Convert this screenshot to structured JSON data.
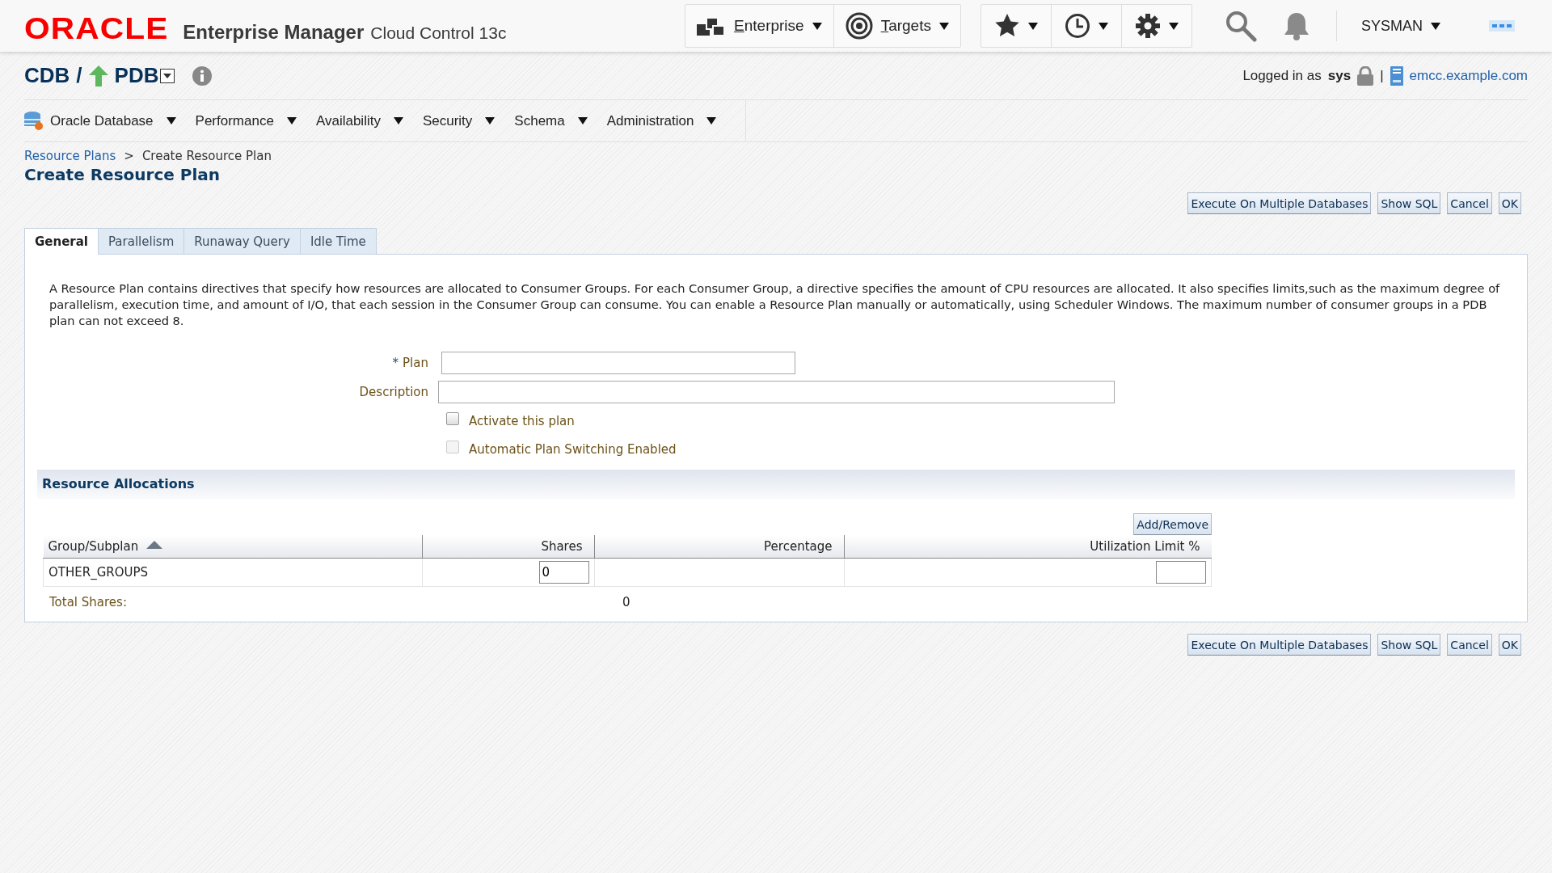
{
  "header": {
    "logo": "ORACLE",
    "product": "Enterprise Manager",
    "edition": "Cloud Control 13c",
    "nav": [
      {
        "kind": "enterprise",
        "label": "Enterprise"
      },
      {
        "kind": "targets",
        "label": "Targets"
      }
    ],
    "tools": [
      {
        "kind": "favorites"
      },
      {
        "kind": "history"
      },
      {
        "kind": "setup"
      }
    ],
    "user": "SYSMAN"
  },
  "target": {
    "container": "CDB",
    "separator": "/",
    "name": "PDB",
    "logged_in_label": "Logged in as",
    "logged_in_user": "sys",
    "divider": "|",
    "host": "emcc.example.com"
  },
  "menu": [
    {
      "kind": "database",
      "label": "Oracle Database"
    },
    {
      "label": "Performance"
    },
    {
      "label": "Availability"
    },
    {
      "label": "Security"
    },
    {
      "label": "Schema"
    },
    {
      "label": "Administration"
    }
  ],
  "breadcrumb": [
    {
      "label": "Resource Plans",
      "kind": "link"
    },
    {
      "label": ">",
      "kind": "separator"
    },
    {
      "label": "Create Resource Plan",
      "kind": "current"
    }
  ],
  "page_title": "Create Resource Plan",
  "actions_top": [
    "Execute On Multiple Databases",
    "Show SQL",
    "Cancel",
    "OK"
  ],
  "tabs": [
    {
      "label": "General",
      "selected": true
    },
    {
      "label": "Parallelism",
      "selected": false
    },
    {
      "label": "Runaway Query",
      "selected": false
    },
    {
      "label": "Idle Time",
      "selected": false
    }
  ],
  "intro": "A Resource Plan contains directives that specify how resources are allocated to Consumer Groups. For each Consumer Group, a directive specifies the amount of CPU resources are allocated. It also specifies limits,such as the maximum degree of parallelism, execution time, and amount of I/O, that each session in the Consumer Group can consume. You can enable a Resource Plan manually or automatically, using Scheduler Windows. The maximum number of consumer groups in a PDB plan can not exceed 8.",
  "fields": [
    {
      "label": "Plan",
      "required_mark": "*",
      "kind": "short"
    },
    {
      "label": "Description",
      "kind": "long"
    }
  ],
  "checkboxes": [
    {
      "label": "Activate this plan",
      "checked": false,
      "disabled": false
    },
    {
      "label": "Automatic Plan Switching Enabled",
      "checked": false,
      "disabled": true
    }
  ],
  "allocations": {
    "title": "Resource Allocations",
    "add_remove": "Add/Remove",
    "columns": [
      {
        "label": "Group/Subplan",
        "sorted": true
      },
      {
        "label": "Shares",
        "sorted": false
      },
      {
        "label": "Percentage",
        "sorted": false
      },
      {
        "label": "Utilization Limit %",
        "sorted": false
      }
    ],
    "rows": [
      {
        "cells": [
          {
            "kind": "text",
            "value": "OTHER_GROUPS"
          },
          {
            "kind": "input",
            "value": "0"
          },
          {
            "kind": "blank"
          },
          {
            "kind": "input"
          }
        ]
      }
    ],
    "total_label": "Total Shares:",
    "total_value": "0"
  },
  "actions_bottom": [
    "Execute On Multiple Databases",
    "Show SQL",
    "Cancel",
    "OK"
  ]
}
